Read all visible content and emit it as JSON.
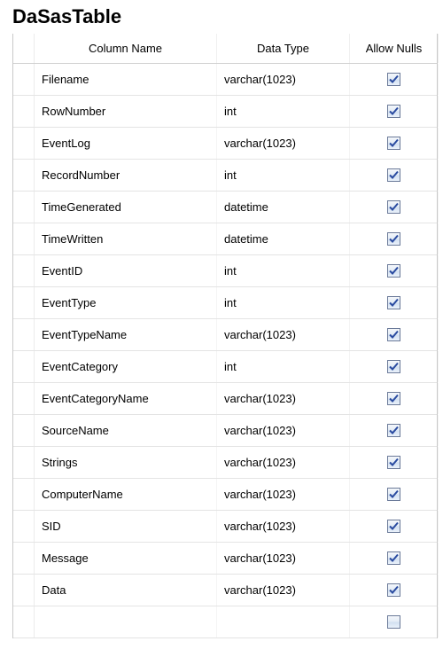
{
  "title": "DaSasTable",
  "headers": {
    "gutter": "",
    "column_name": "Column Name",
    "data_type": "Data Type",
    "allow_nulls": "Allow Nulls"
  },
  "rows": [
    {
      "name": "Filename",
      "type": "varchar(1023)",
      "allow_nulls": true
    },
    {
      "name": "RowNumber",
      "type": "int",
      "allow_nulls": true
    },
    {
      "name": "EventLog",
      "type": "varchar(1023)",
      "allow_nulls": true
    },
    {
      "name": "RecordNumber",
      "type": "int",
      "allow_nulls": true
    },
    {
      "name": "TimeGenerated",
      "type": "datetime",
      "allow_nulls": true
    },
    {
      "name": "TimeWritten",
      "type": "datetime",
      "allow_nulls": true
    },
    {
      "name": "EventID",
      "type": "int",
      "allow_nulls": true
    },
    {
      "name": "EventType",
      "type": "int",
      "allow_nulls": true
    },
    {
      "name": "EventTypeName",
      "type": "varchar(1023)",
      "allow_nulls": true
    },
    {
      "name": "EventCategory",
      "type": "int",
      "allow_nulls": true
    },
    {
      "name": "EventCategoryName",
      "type": "varchar(1023)",
      "allow_nulls": true
    },
    {
      "name": "SourceName",
      "type": "varchar(1023)",
      "allow_nulls": true
    },
    {
      "name": "Strings",
      "type": "varchar(1023)",
      "allow_nulls": true
    },
    {
      "name": "ComputerName",
      "type": "varchar(1023)",
      "allow_nulls": true
    },
    {
      "name": "SID",
      "type": "varchar(1023)",
      "allow_nulls": true
    },
    {
      "name": "Message",
      "type": "varchar(1023)",
      "allow_nulls": true
    },
    {
      "name": "Data",
      "type": "varchar(1023)",
      "allow_nulls": true
    },
    {
      "name": "",
      "type": "",
      "allow_nulls": false
    }
  ]
}
